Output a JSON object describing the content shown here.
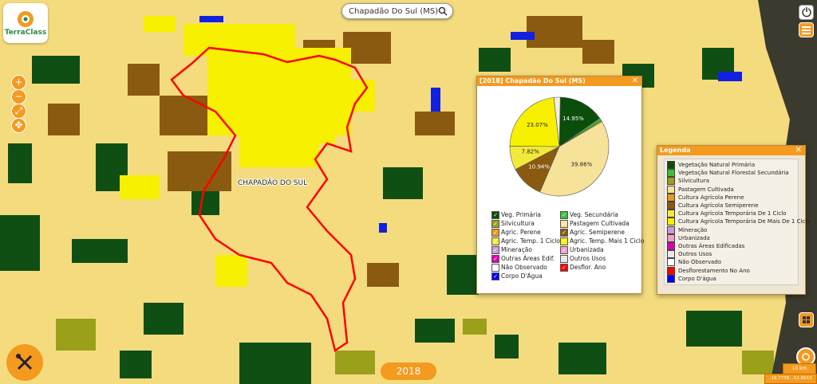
{
  "search": {
    "value": "Chapadão Do Sul (MS)"
  },
  "logo": {
    "text": "TerraClass"
  },
  "map": {
    "place_label": "CHAPADÃO DO SUL"
  },
  "chart_panel": {
    "title": "[2018] Chapadão Do Sul (MS)"
  },
  "chart_data": {
    "type": "pie",
    "slices": [
      {
        "label": "Veg. Primária",
        "value": 14.95,
        "color": "#0b4d0b"
      },
      {
        "label": "Veg. Secundária",
        "value": 0.8,
        "color": "#3cbf3c"
      },
      {
        "label": "Silvicultura",
        "value": 0.5,
        "color": "#9aa01a"
      },
      {
        "label": "Pastagem Cultivada",
        "value": 39.86,
        "color": "#f7e29a"
      },
      {
        "label": "Agric. Semiperene",
        "value": 10.94,
        "color": "#8a5a10"
      },
      {
        "label": "Agric. Temp. 1 Ciclo",
        "value": 7.82,
        "color": "#f2ea3a"
      },
      {
        "label": "Agric. Temp. Mais 1 Ciclo",
        "value": 23.07,
        "color": "#f7f000"
      },
      {
        "label": "Outros",
        "value": 2.06,
        "color": "#f3f1e4"
      }
    ],
    "data_labels": [
      "14.95%",
      "39.86%",
      "10.94%",
      "7.82%",
      "23.07%"
    ]
  },
  "chart_legend": [
    [
      "Veg. Primária",
      "Veg. Secundária"
    ],
    [
      "Silvicultura",
      "Pastagem Cultivada"
    ],
    [
      "Agric. Perene",
      "Agric. Semiperene"
    ],
    [
      "Agric. Temp. 1 Ciclo",
      "Agric. Temp. Mais 1 Ciclo"
    ],
    [
      "Mineração",
      "Urbanizada"
    ],
    [
      "Outras Áreas Edif.",
      "Outros Usos"
    ],
    [
      "Não Observado",
      "Desflor. Ano"
    ],
    [
      "Corpo D'Água",
      ""
    ]
  ],
  "chart_legend_colors": [
    [
      "#0b4d0b",
      "#3cbf3c"
    ],
    [
      "#9aa01a",
      "#f7e29a"
    ],
    [
      "#e89a1a",
      "#8a5a10"
    ],
    [
      "#f2ea3a",
      "#f7f000"
    ],
    [
      "#c99ad6",
      "#f2a0c8"
    ],
    [
      "#e000b0",
      "#e8e8e8"
    ],
    [
      "#ffffff",
      "#ff0000"
    ],
    [
      "#0000ff",
      ""
    ]
  ],
  "legend_panel": {
    "title": "Legenda",
    "items": [
      {
        "label": "Vegetação Natural Primária",
        "color": "#0b4d0b"
      },
      {
        "label": "Vegetação Natural Florestal Secundária",
        "color": "#3cbf3c"
      },
      {
        "label": "Silvicultura",
        "color": "#9aa01a"
      },
      {
        "label": "Pastagem Cultivada",
        "color": "#f7e29a"
      },
      {
        "label": "Cultura Agrícola Perene",
        "color": "#e89a1a"
      },
      {
        "label": "Cultura Agrícola Semiperene",
        "color": "#8a5a10"
      },
      {
        "label": "Cultura Agrícola Temporária De 1 Ciclo",
        "color": "#f2ea3a"
      },
      {
        "label": "Cultura Agrícola Temporária De Mais De 1 Ciclo",
        "color": "#f7f000"
      },
      {
        "label": "Mineração",
        "color": "#c99ad6"
      },
      {
        "label": "Urbanizada",
        "color": "#f2a0c8"
      },
      {
        "label": "Outras Áreas Edificadas",
        "color": "#e000b0"
      },
      {
        "label": "Outros Usos",
        "color": "#e8e8e8"
      },
      {
        "label": "Não Observado",
        "color": "#ffffff"
      },
      {
        "label": "Desflorestamento No Ano",
        "color": "#ff0000"
      },
      {
        "label": "Corpo D'água",
        "color": "#0000ff"
      }
    ]
  },
  "year": {
    "label": "2018"
  },
  "scale": {
    "label": "10 km"
  },
  "coords": {
    "label": "-18.7738, -52.6553"
  }
}
